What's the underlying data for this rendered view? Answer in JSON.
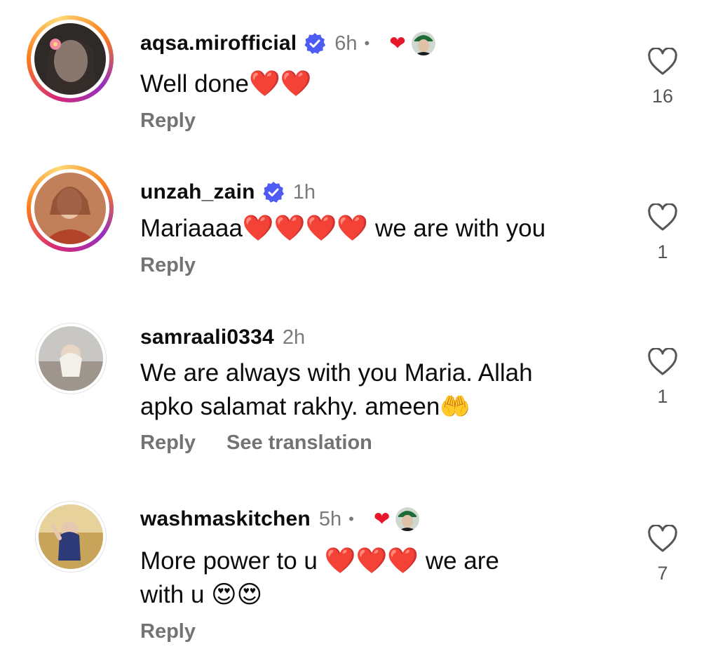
{
  "comments": [
    {
      "username": "aqsa.mirofficial",
      "verified": true,
      "time": "6h",
      "liked_by_author": true,
      "text": "Well done",
      "text_after": "",
      "emojis": "❤️❤️",
      "reply_label": "Reply",
      "like_count": "16",
      "avatar_ring": true
    },
    {
      "username": "unzah_zain",
      "verified": true,
      "time": "1h",
      "liked_by_author": false,
      "text": "Mariaaaa",
      "emojis": "❤️❤️❤️❤️",
      "text_after": " we are with you",
      "reply_label": "Reply",
      "like_count": "1",
      "avatar_ring": true
    },
    {
      "username": "samraali0334",
      "verified": false,
      "time": "2h",
      "liked_by_author": false,
      "text_line1": "We are always with you Maria. Allah",
      "text_line2": "apko salamat rakhy. ameen",
      "emojis": "🤲",
      "reply_label": "Reply",
      "translation_label": "See translation",
      "like_count": "1",
      "avatar_ring": false
    },
    {
      "username": "washmaskitchen",
      "verified": false,
      "time": "5h",
      "liked_by_author": true,
      "text_line1": "More power to u ",
      "emojis_line1": "❤️❤️❤️",
      "text_line1_after": " we are",
      "text_line2": "with u ",
      "emojis_line2": "😍😍",
      "reply_label": "Reply",
      "like_count": "7",
      "avatar_ring": false
    }
  ],
  "colors": {
    "username": "#0c0c0c",
    "secondary": "#737373",
    "heart": "#e8182c",
    "verified": "#4e5bf5"
  },
  "icons": {
    "verified": "verified-badge-icon",
    "like": "heart-outline-icon",
    "creator_like": "red-heart-icon"
  }
}
